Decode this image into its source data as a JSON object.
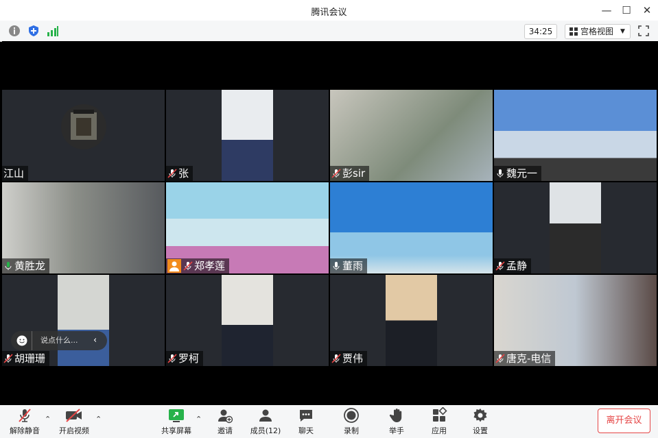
{
  "window": {
    "title": "腾讯会议"
  },
  "topbar": {
    "timer": "34:25",
    "view_label": "宫格视图"
  },
  "participants": [
    {
      "name": "江山",
      "muted": false,
      "mic": false
    },
    {
      "name": "张",
      "muted": true,
      "mic": true
    },
    {
      "name": "彭sir",
      "muted": true,
      "mic": true
    },
    {
      "name": "魏元一",
      "muted": false,
      "mic": true
    },
    {
      "name": "黄胜龙",
      "muted": false,
      "mic": true,
      "speaking": true
    },
    {
      "name": "郑孝莲",
      "muted": true,
      "mic": true,
      "host": true
    },
    {
      "name": "董雨",
      "muted": false,
      "mic": true
    },
    {
      "name": "孟静",
      "muted": true,
      "mic": true
    },
    {
      "name": "胡珊珊",
      "muted": true,
      "mic": true
    },
    {
      "name": "罗柯",
      "muted": true,
      "mic": true
    },
    {
      "name": "贾伟",
      "muted": true,
      "mic": true
    },
    {
      "name": "唐克-电信",
      "muted": true,
      "mic": true
    }
  ],
  "chat_popup": {
    "placeholder": "说点什么..."
  },
  "toolbar": {
    "unmute": "解除静音",
    "start_video": "开启视频",
    "share_screen": "共享屏幕",
    "invite": "邀请",
    "members": "成员(12)",
    "chat": "聊天",
    "record": "录制",
    "raise_hand": "举手",
    "apps": "应用",
    "settings": "设置",
    "leave": "离开会议"
  },
  "colors": {
    "accent_green": "#27b24a",
    "leave_red": "#e54545"
  }
}
